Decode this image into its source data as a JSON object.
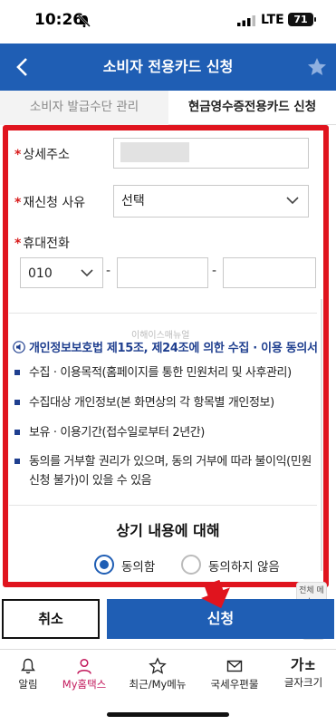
{
  "status_bar": {
    "time": "10:26",
    "network": "LTE",
    "battery": "71"
  },
  "header": {
    "title": "소비자 전용카드 신청"
  },
  "tabs": [
    {
      "label": "소비자 발급수단 관리",
      "active": false
    },
    {
      "label": "현금영수증전용카드 신청",
      "active": true
    }
  ],
  "form": {
    "address": {
      "label": "상세주소",
      "required": true
    },
    "reason": {
      "label": "재신청 사유",
      "required": true,
      "selected": "선택"
    },
    "phone": {
      "label": "휴대전화",
      "required": true,
      "prefix": "010",
      "separator": "-"
    }
  },
  "watermark": "이해이스매뉴얼",
  "consent": {
    "title": "개인정보보호법 제15조, 제24조에 의한 수집 · 이용 동의서",
    "items": [
      "수집 · 이용목적(홈페이지를 통한 민원처리 및 사후관리)",
      "수집대상 개인정보(본 화면상의 각 항목별 개인정보)",
      "보유 · 이용기간(접수일로부터 2년간)",
      "동의를 거부할 권리가 있으며, 동의 거부에 따라 불이익(민원 신청 불가)이 있을 수 있음"
    ],
    "agree_heading": "상기 내용에 대해",
    "options": [
      {
        "label": "동의함",
        "selected": true
      },
      {
        "label": "동의하지 않음",
        "selected": false
      }
    ]
  },
  "floating": {
    "menu_label": "전체 메뉴"
  },
  "actions": {
    "cancel": "취소",
    "submit": "신청"
  },
  "bottom_nav": [
    {
      "label": "알림",
      "icon": "bell-icon",
      "active": false
    },
    {
      "label": "My홈택스",
      "icon": "person-icon",
      "active": true
    },
    {
      "label": "최근/My메뉴",
      "icon": "star-icon",
      "active": false
    },
    {
      "label": "국세우편물",
      "icon": "mail-icon",
      "active": false
    },
    {
      "label": "글자크기",
      "icon": "font-size-icon",
      "glyph": "가±",
      "active": false
    }
  ],
  "colors": {
    "primary": "#1f5eb4",
    "highlight": "#e0141e",
    "required": "#d81b1b",
    "active_nav": "#c2185b"
  }
}
